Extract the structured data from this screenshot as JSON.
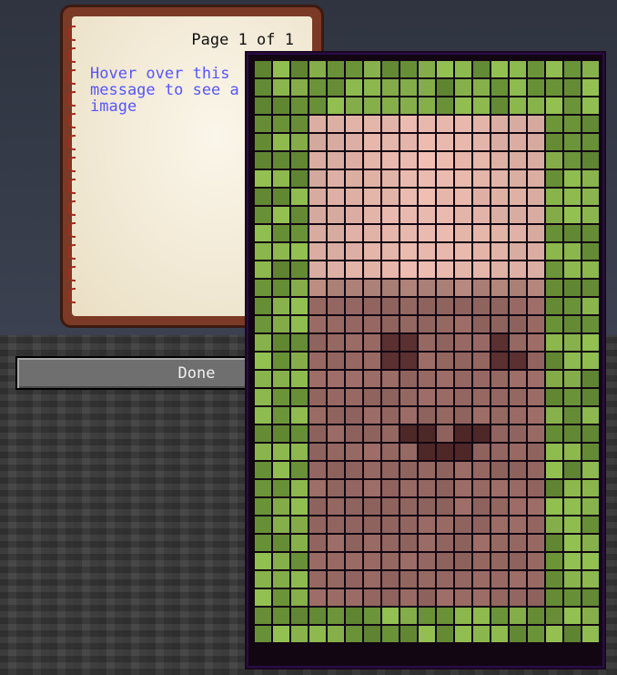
{
  "book": {
    "page_indicator": "Page 1 of 1",
    "text_lines": [
      "Hover over this",
      "message to see a",
      "image"
    ]
  },
  "done_button": {
    "label": "Done"
  },
  "tooltip_image": {
    "columns": 19,
    "rows": 32,
    "colors": {
      "grass": "#6f9a3a",
      "grass_light": "#86b04a",
      "skin_top": "#e8b8ac",
      "skin": "#b98a80",
      "face": "#9c6c66",
      "eye": "#5a3030",
      "mouth": "#4e2727",
      "border": "#1b0d1b"
    }
  }
}
